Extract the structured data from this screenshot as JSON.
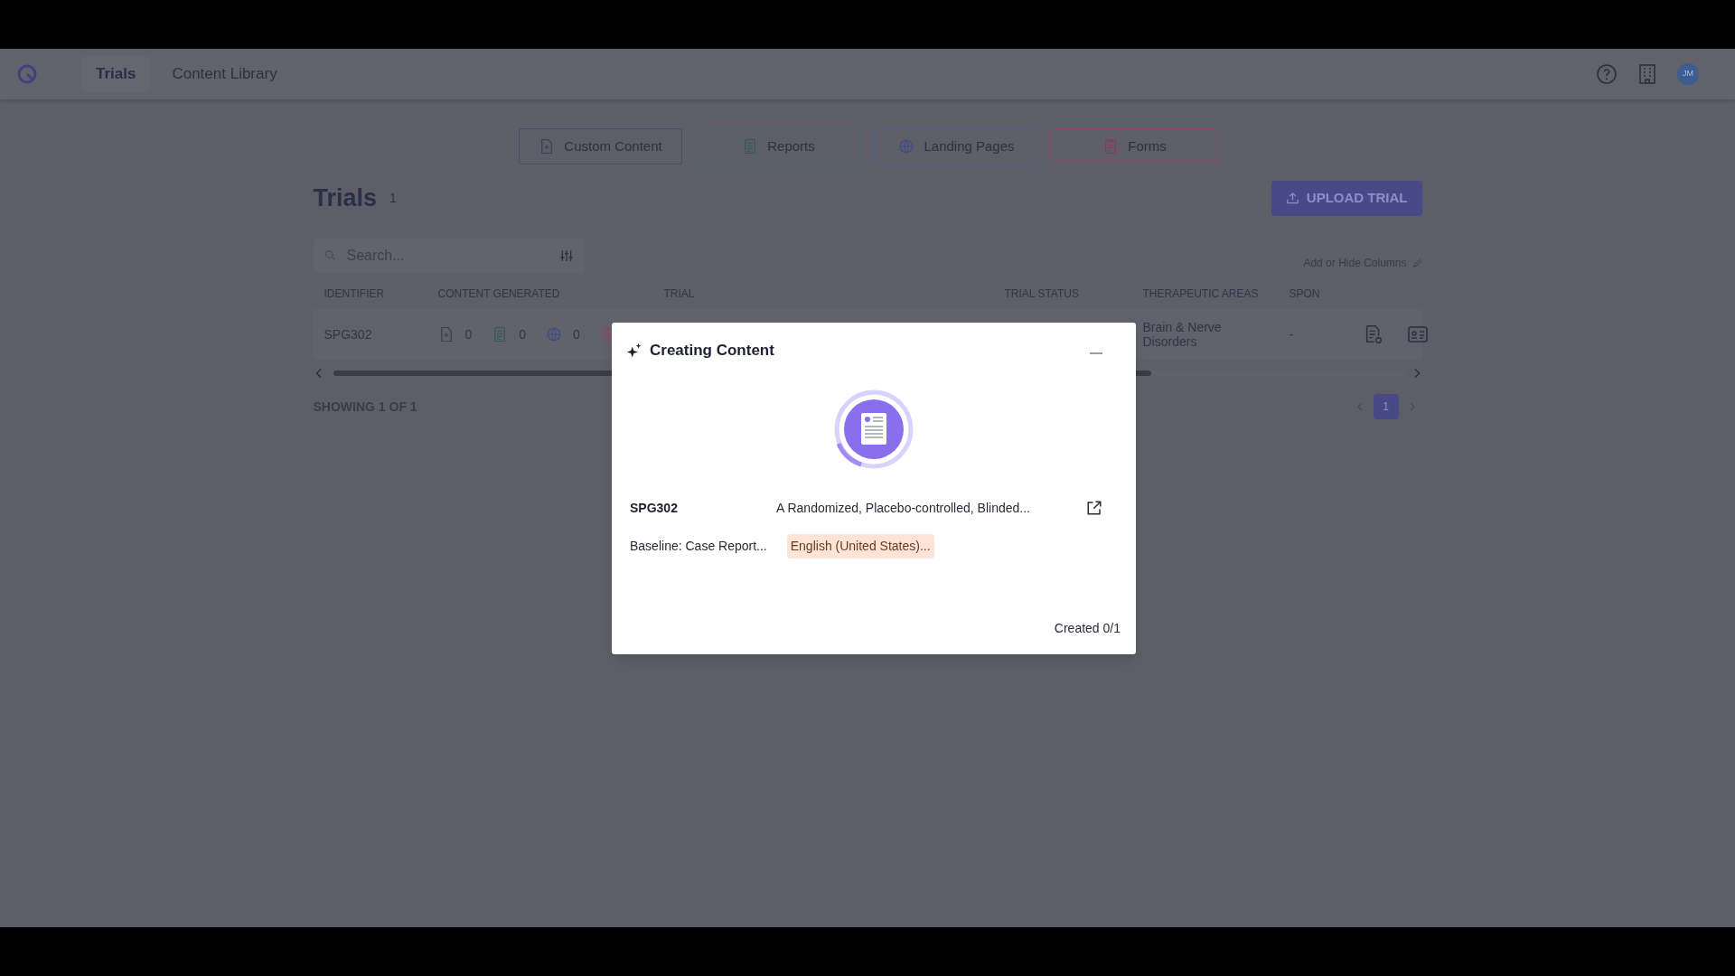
{
  "nav": {
    "tabs": [
      {
        "label": "Trials",
        "selected": true
      },
      {
        "label": "Content Library",
        "selected": false
      }
    ],
    "avatar": "JM"
  },
  "content_buttons": [
    {
      "kind": "custom",
      "label": "Custom Content"
    },
    {
      "kind": "reports",
      "label": "Reports"
    },
    {
      "kind": "landing",
      "label": "Landing Pages"
    },
    {
      "kind": "forms",
      "label": "Forms"
    }
  ],
  "header": {
    "title": "Trials",
    "count": "1",
    "upload_button": "UPLOAD TRIAL"
  },
  "search": {
    "placeholder": "Search..."
  },
  "columns_link": "Add or Hide Columns",
  "table": {
    "columns": [
      "IDENTIFIER",
      "CONTENT GENERATED",
      "TRIAL",
      "TRIAL STATUS",
      "THERAPEUTIC AREAS",
      "SPON"
    ],
    "rows": [
      {
        "identifier": "SPG302",
        "content": [
          {
            "kind": "custom",
            "count": "0"
          },
          {
            "kind": "reports",
            "count": "0"
          },
          {
            "kind": "landing",
            "count": "0"
          }
        ],
        "therapeutic_areas": "Brain & Nerve Disorders",
        "sponsor": "-"
      }
    ]
  },
  "showing": "SHOWING 1 OF 1",
  "pagination": [
    {
      "label": "1",
      "selected": true
    }
  ],
  "modal": {
    "title": "Creating Content",
    "identifier": "SPG302",
    "trial": "A Randomized, Placebo-controlled, Blinded...",
    "item": "Baseline: Case Report...",
    "language": "English (United States)...",
    "progress": "Created 0/1"
  }
}
